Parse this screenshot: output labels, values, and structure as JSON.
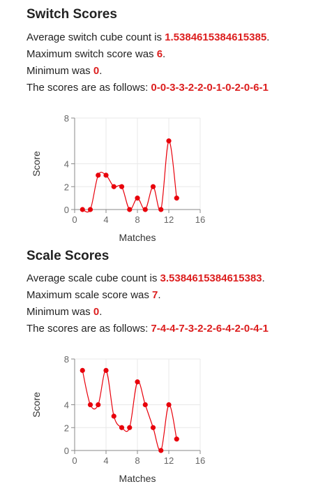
{
  "switch": {
    "heading": "Switch Scores",
    "avg_prefix": "Average switch cube count is ",
    "avg_value": "1.5384615384615385",
    "avg_suffix": ".",
    "max_prefix": "Maximum switch score was ",
    "max_value": "6",
    "max_suffix": ".",
    "min_prefix": "Minimum was ",
    "min_value": "0",
    "min_suffix": ".",
    "scores_prefix": "The scores are as follows: ",
    "scores_value": "0-0-3-3-2-2-0-1-0-2-0-6-1"
  },
  "scale": {
    "heading": "Scale Scores",
    "avg_prefix": "Average scale cube count is ",
    "avg_value": "3.5384615384615383",
    "avg_suffix": ".",
    "max_prefix": "Maximum scale score was ",
    "max_value": "7",
    "max_suffix": ".",
    "min_prefix": "Minimum was ",
    "min_value": "0",
    "min_suffix": ".",
    "scores_prefix": "The scores are as follows: ",
    "scores_value": "7-4-4-7-3-2-2-6-4-2-0-4-1"
  },
  "colors": {
    "highlight": "#dc1e1e",
    "line": "#e8000b",
    "grid": "#e8e8e8",
    "axis": "#888888"
  },
  "chart_data": [
    {
      "type": "line",
      "xlabel": "Matches",
      "ylabel": "Score",
      "xlim": [
        0,
        16
      ],
      "ylim": [
        0,
        8
      ],
      "xticks": [
        0,
        4,
        8,
        12,
        16
      ],
      "yticks": [
        0,
        2,
        4,
        8
      ],
      "x": [
        1,
        2,
        3,
        4,
        5,
        6,
        7,
        8,
        9,
        10,
        11,
        12,
        13
      ],
      "series": [
        {
          "values": [
            0,
            0,
            3,
            3,
            2,
            2,
            0,
            1,
            0,
            2,
            0,
            6,
            1
          ]
        }
      ],
      "grid": true,
      "curve": "smooth"
    },
    {
      "type": "line",
      "xlabel": "Matches",
      "ylabel": "Score",
      "xlim": [
        0,
        16
      ],
      "ylim": [
        0,
        8
      ],
      "xticks": [
        0,
        4,
        8,
        12,
        16
      ],
      "yticks": [
        0,
        2,
        4,
        8
      ],
      "x": [
        1,
        2,
        3,
        4,
        5,
        6,
        7,
        8,
        9,
        10,
        11,
        12,
        13
      ],
      "series": [
        {
          "values": [
            7,
            4,
            4,
            7,
            3,
            2,
            2,
            6,
            4,
            2,
            0,
            4,
            1
          ]
        }
      ],
      "grid": true,
      "curve": "smooth"
    }
  ]
}
